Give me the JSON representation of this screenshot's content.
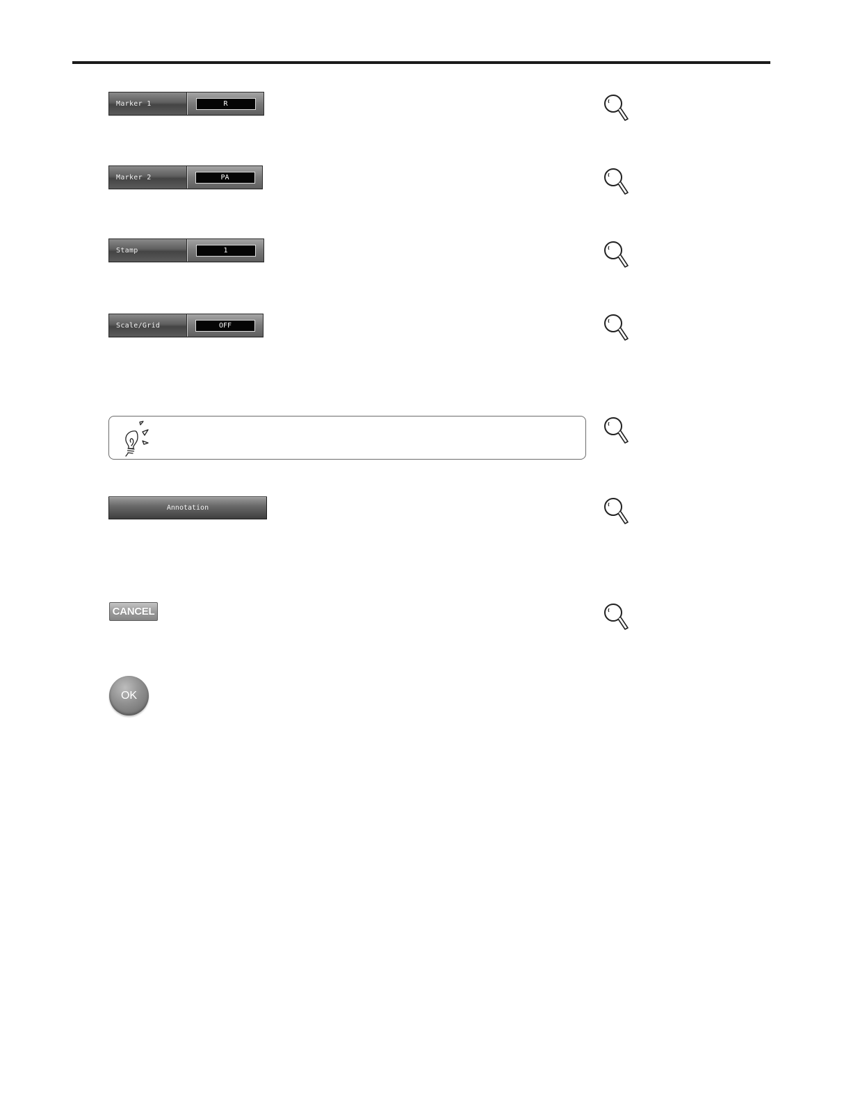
{
  "settings": [
    {
      "label": "Marker 1",
      "value": "R"
    },
    {
      "label": "Marker 2",
      "value": "PA"
    },
    {
      "label": "Stamp",
      "value": "1"
    },
    {
      "label": "Scale/Grid",
      "value": "OFF"
    }
  ],
  "buttons": {
    "annotation_label": "Annotation",
    "cancel_label": "CANCEL",
    "ok_label": "OK"
  },
  "icons": {
    "magnifier": "magnifier-icon",
    "tip": "lightbulb-icon"
  },
  "colors": {
    "rule": "#1a1a1a",
    "value_bg": "#050505",
    "button_gray": "#6a6a6a"
  }
}
